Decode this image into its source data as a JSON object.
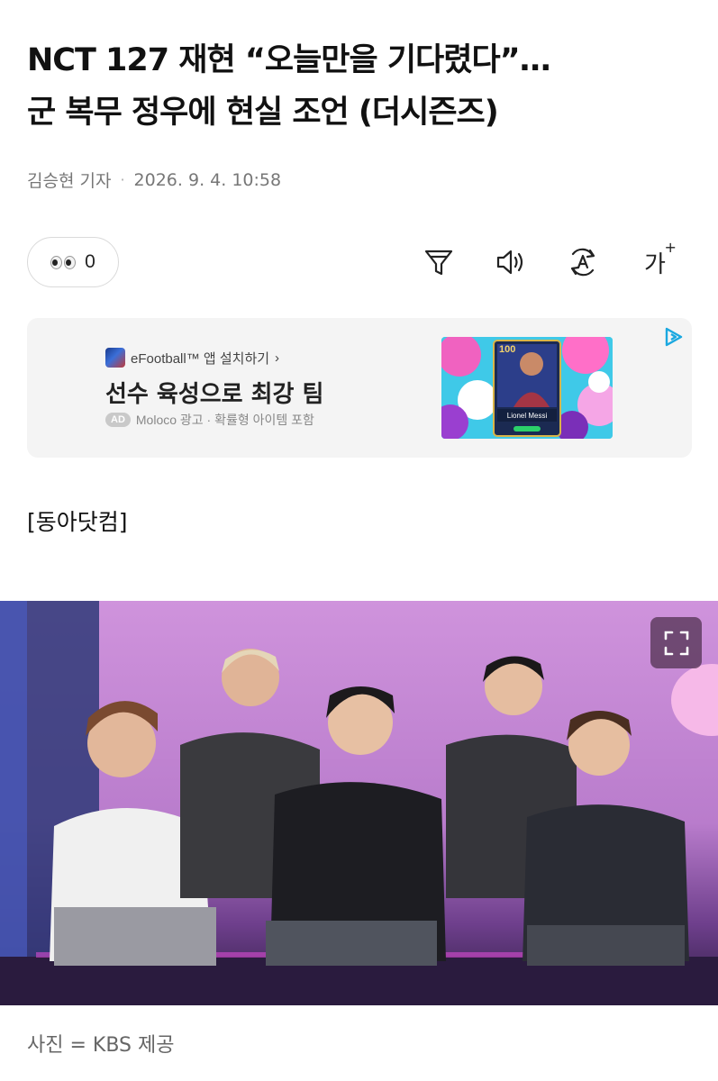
{
  "article": {
    "headline_line1": "NCT 127 재현 “오늘만을 기다렸다”…",
    "headline_line2": "군 복무 정우에 현실 조언 (더시즌즈)",
    "author": "김승현 기자",
    "separator": "·",
    "datetime": "2026. 9. 4. 10:58",
    "source_tag": "[동아닷컴]",
    "photo_caption": "사진 = KBS 제공"
  },
  "reaction": {
    "icon": "eyes-emoji-icon",
    "count": "0"
  },
  "toolbar": {
    "filter_icon": "funnel-filter-icon",
    "audio_icon": "speaker-icon",
    "translate_icon": "auto-translate-icon",
    "font_size_label": "가",
    "font_size_plus": "+"
  },
  "ad": {
    "source_label": "eFootball™ 앱 설치하기",
    "source_chevron": "›",
    "title": "선수 육성으로 최강 팀",
    "badge": "AD",
    "meta": "Moloco 광고 · 확률형 아이템 포함",
    "card_rating": "100",
    "card_player": "Lionel Messi",
    "choices_icon": "ad-choices-icon"
  },
  "photo": {
    "expand_icon": "expand-fullscreen-icon"
  },
  "colors": {
    "text_primary": "#111111",
    "text_secondary": "#777777",
    "ad_background": "#f4f4f4",
    "stage_pink": "#c68ad8",
    "ad_choices": "#1aa8e0"
  }
}
